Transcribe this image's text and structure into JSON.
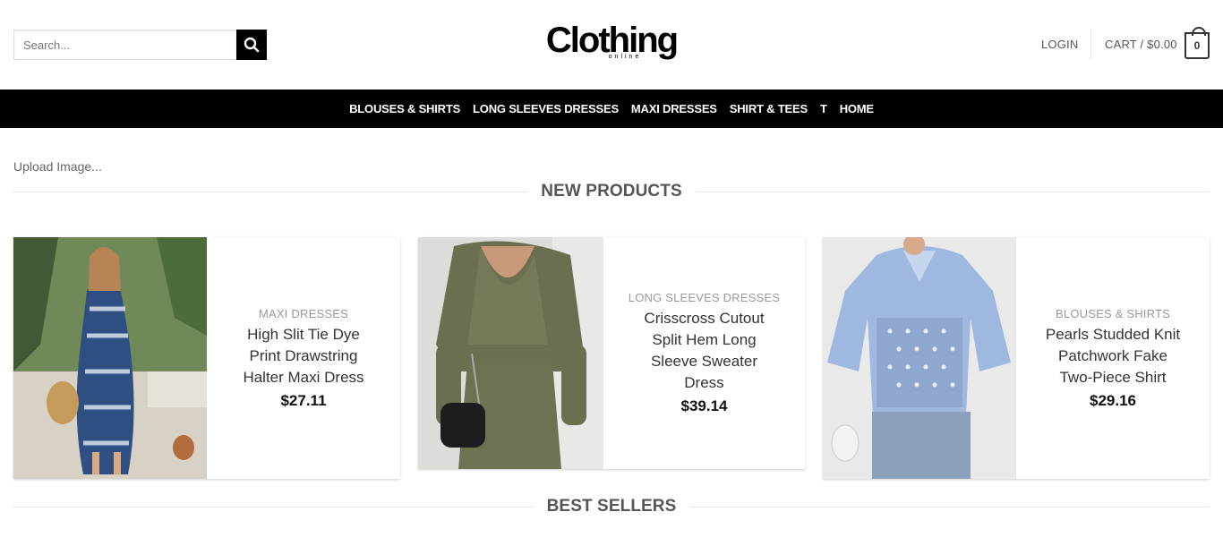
{
  "header": {
    "search_placeholder": "Search...",
    "logo_main": "Clothing",
    "logo_sub": "online",
    "login": "LOGIN",
    "cart": "CART / $0.00",
    "cart_count": "0"
  },
  "nav": {
    "items": [
      "BLOUSES & SHIRTS",
      "LONG SLEEVES DRESSES",
      "MAXI DRESSES",
      "SHIRT & TEES",
      "T",
      "HOME"
    ]
  },
  "upload_label": "Upload Image...",
  "sections": {
    "new_products": "NEW PRODUCTS",
    "best_sellers": "BEST SELLERS"
  },
  "products": [
    {
      "category": "MAXI DRESSES",
      "name_lines": [
        "High Slit Tie Dye",
        "Print Drawstring",
        "Halter Maxi Dress"
      ],
      "price": "$27.11"
    },
    {
      "category": "LONG SLEEVES DRESSES",
      "name_lines": [
        "Crisscross Cutout",
        "Split Hem Long",
        "Sleeve Sweater",
        "Dress"
      ],
      "price": "$39.14"
    },
    {
      "category": "BLOUSES & SHIRTS",
      "name_lines": [
        "Pearls Studded Knit",
        "Patchwork Fake",
        "Two-Piece Shirt"
      ],
      "price": "$29.16"
    }
  ],
  "colors": {
    "nav_bg": "#000000",
    "accent": "#000000"
  }
}
